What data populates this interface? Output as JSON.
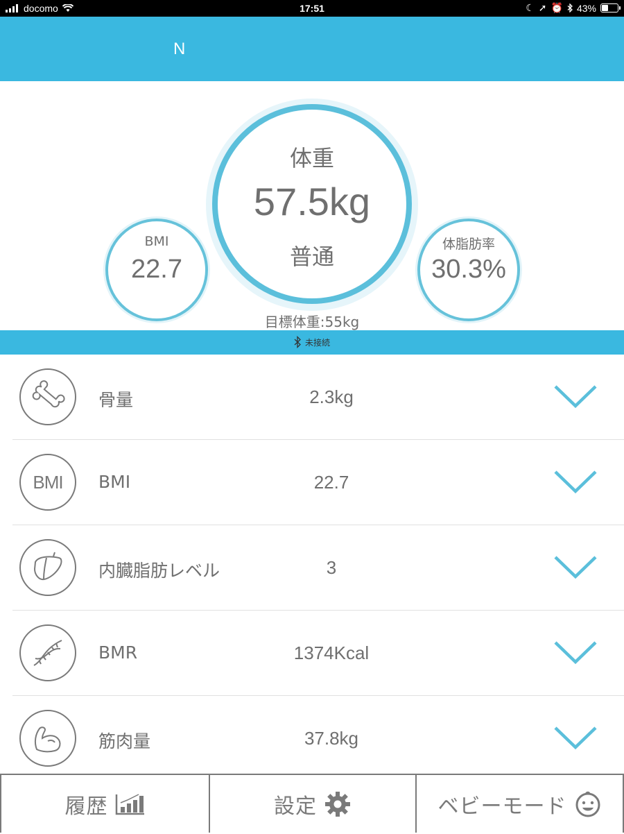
{
  "status_bar": {
    "carrier": "docomo",
    "time": "17:51",
    "battery": "43%",
    "battery_level": 0.43
  },
  "header": {
    "title": "N"
  },
  "summary": {
    "weight_label": "体重",
    "weight_value": "57.5kg",
    "weight_status": "普通",
    "bmi_label": "BMI",
    "bmi_value": "22.7",
    "fat_label": "体脂肪率",
    "fat_value": "30.3%",
    "target": "目標体重:55kg"
  },
  "connection": {
    "status": "未接続",
    "icon": "bluetooth-icon"
  },
  "metrics": [
    {
      "label": "骨量",
      "value": "2.3kg",
      "icon": "bone-icon"
    },
    {
      "label": "BMI",
      "value": "22.7",
      "icon": "bmi-icon",
      "icon_text": "BMI"
    },
    {
      "label": "内臓脂肪レベル",
      "value": "3",
      "icon": "liver-icon"
    },
    {
      "label": "BMR",
      "value": "1374Kcal",
      "icon": "dna-icon"
    },
    {
      "label": "筋肉量",
      "value": "37.8kg",
      "icon": "muscle-arm-icon"
    }
  ],
  "tabs": [
    {
      "label": "履歴",
      "icon": "bar-chart-icon"
    },
    {
      "label": "設定",
      "icon": "gear-icon"
    },
    {
      "label": "ベビーモード",
      "icon": "baby-face-icon"
    }
  ],
  "colors": {
    "accent": "#3ab8e0",
    "ring": "#5bbfdb",
    "chevron": "#5bbfdb",
    "text": "#6f6f6f"
  }
}
